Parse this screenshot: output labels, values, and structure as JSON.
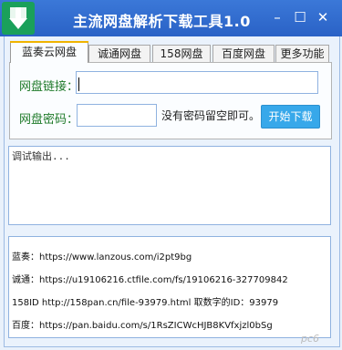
{
  "window": {
    "title": "主流网盘解析下载工具1.0"
  },
  "tabs": [
    "蓝奏云网盘",
    "诚通网盘",
    "158网盘",
    "百度网盘",
    "更多功能"
  ],
  "form": {
    "link_label": "网盘链接：",
    "link_value": "",
    "password_label": "网盘密码：",
    "password_value": "",
    "hint": "没有密码留空即可。",
    "start_button": "开始下载"
  },
  "debug_output": "调试输出...",
  "info_lines": [
    "蓝奏：https://www.lanzous.com/i2pt9bg",
    "诚通：https://u19106216.ctfile.com/fs/19106216-327709842",
    "158ID http://158pan.cn/file-93979.html 取数字的ID：93979",
    "百度：https://pan.baidu.com/s/1RsZICWcHJB8KVfxjzl0bSg"
  ],
  "watermark": "pc6"
}
